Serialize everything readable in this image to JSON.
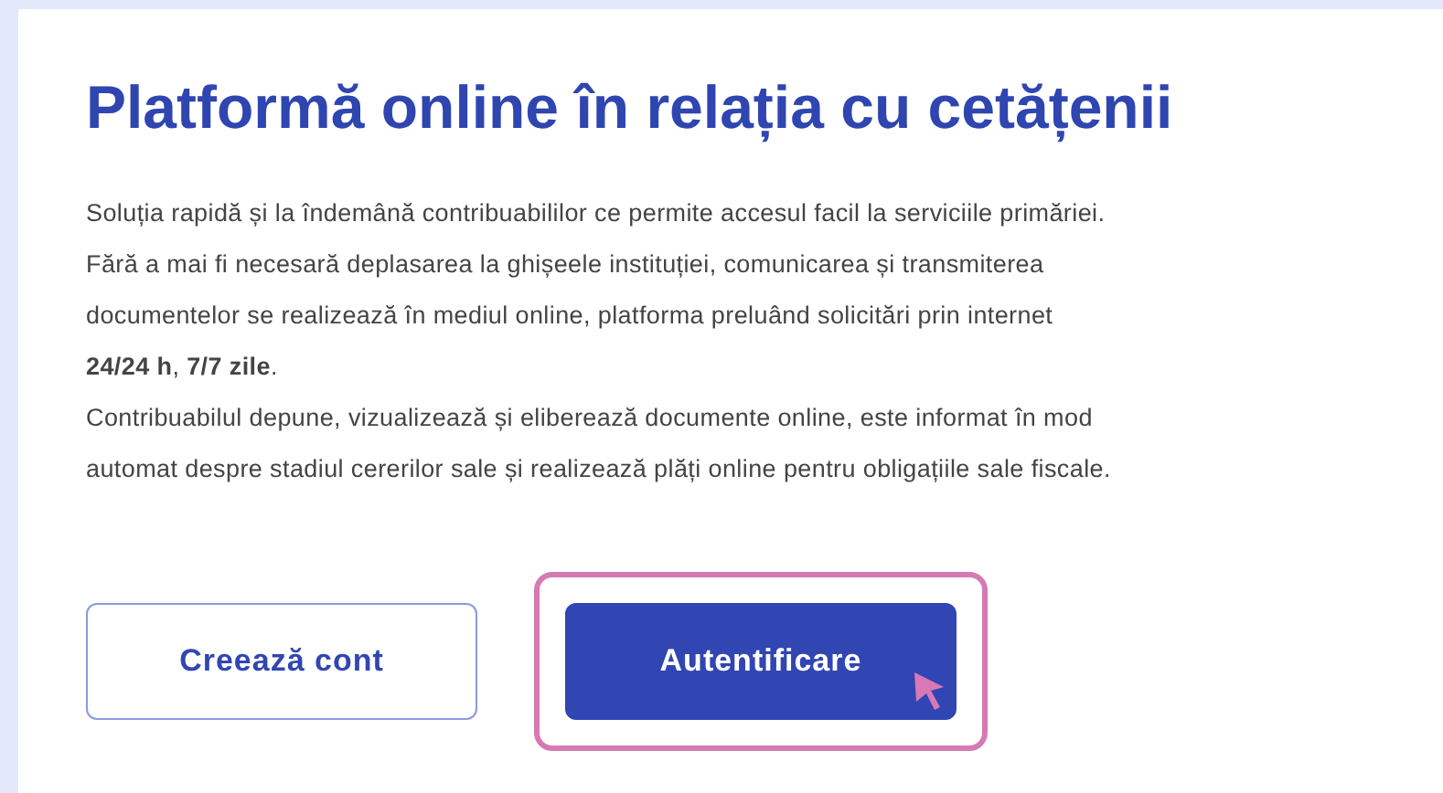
{
  "title": "Platformă online în relația cu cetățenii",
  "lines": [
    "Soluția rapidă și la îndemână contribuabililor ce permite accesul facil la serviciile primăriei.",
    "Fără a mai fi necesară deplasarea la ghișeele instituției, comunicarea și transmiterea",
    "documentelor se realizează în mediul online, platforma preluând solicitări prin internet",
    "**24/24 h**, **7/7 zile**.",
    "Contribuabilul depune, vizualizează și eliberează documente online, este informat în mod",
    "automat despre stadiul cererilor sale și realizează plăți online pentru obligațiile sale fiscale."
  ],
  "buttons": [
    {
      "label": "Creează cont",
      "kind": "outline",
      "highlighted": false
    },
    {
      "label": "Autentificare",
      "kind": "primary",
      "highlighted": true
    }
  ]
}
